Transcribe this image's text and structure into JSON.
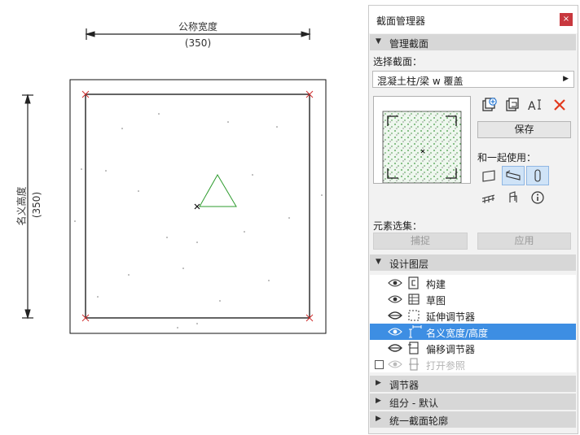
{
  "canvas": {
    "top_dim_label": "公称宽度",
    "top_dim_value": "(350)",
    "side_dim_label": "名义高度",
    "side_dim_value": "(350)"
  },
  "panel": {
    "title": "截面管理器",
    "close_glyph": "×",
    "manage_section": {
      "label": "管理截面",
      "tri": "▼"
    },
    "select_label": "选择截面：",
    "selected_profile": "混凝土柱/梁 w 覆盖",
    "dropdown_arrow": "▶",
    "save_label": "保存",
    "use_with_label": "和一起使用：",
    "element_set_label": "元素选集：",
    "capture_label": "捕捉",
    "apply_label": "应用",
    "design_layers": {
      "label": "设计图层",
      "tri": "▼"
    },
    "layers": [
      {
        "name": "构建",
        "icon": "construction-layer-icon",
        "visible": true,
        "selected": false
      },
      {
        "name": "草图",
        "icon": "sketch-layer-icon",
        "visible": true,
        "selected": false
      },
      {
        "name": "延伸调节器",
        "icon": "stretch-modifier-icon",
        "visible": false,
        "selected": false
      },
      {
        "name": "名义宽度/高度",
        "icon": "nominal-size-icon",
        "visible": true,
        "selected": true
      },
      {
        "name": "偏移调节器",
        "icon": "offset-modifier-icon",
        "visible": false,
        "selected": false
      },
      {
        "name": "打开参照",
        "icon": "open-reference-icon",
        "visible": true,
        "selected": false,
        "disabled": true
      }
    ],
    "collapsed_sections": [
      {
        "label": "调节器",
        "tri": "▶"
      },
      {
        "label": "组分 - 默认",
        "tri": "▶"
      },
      {
        "label": "统一截面轮廓",
        "tri": "▶"
      }
    ]
  }
}
